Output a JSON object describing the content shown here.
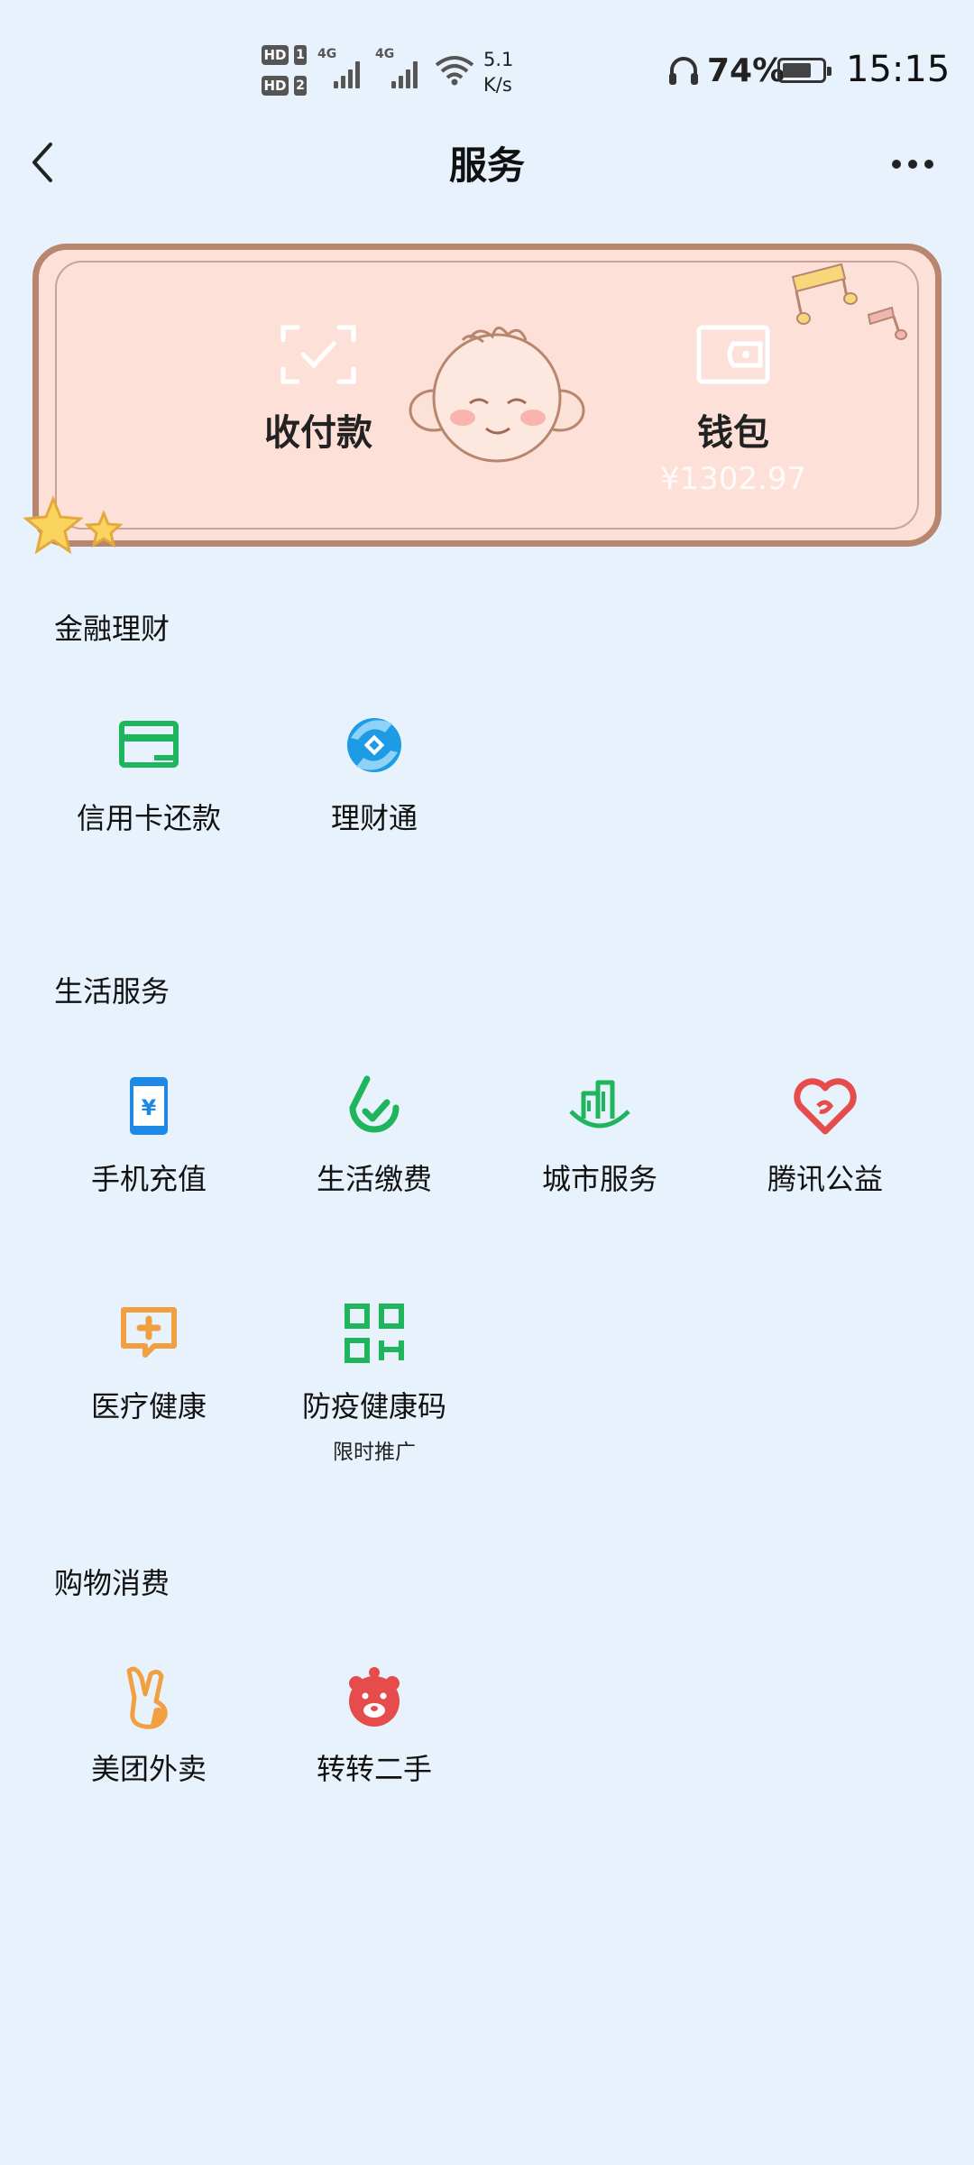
{
  "status_bar": {
    "hd1": "HD",
    "hd1_num": "1",
    "hd2": "HD",
    "hd2_num": "2",
    "net1": "4G",
    "net2": "4G",
    "speed_value": "5.1",
    "speed_unit": "K/s",
    "battery_percent": "74%",
    "battery_level": 0.74,
    "time": "15:15"
  },
  "header": {
    "title": "服务"
  },
  "card": {
    "pay_label": "收付款",
    "wallet_label": "钱包",
    "wallet_balance": "¥1302.97"
  },
  "sections": {
    "finance": {
      "title": "金融理财",
      "items": [
        {
          "label": "信用卡还款",
          "icon": "credit-card-icon"
        },
        {
          "label": "理财通",
          "icon": "licaitong-icon"
        }
      ]
    },
    "life": {
      "title": "生活服务",
      "items": [
        {
          "label": "手机充值",
          "icon": "phone-recharge-icon"
        },
        {
          "label": "生活缴费",
          "icon": "utility-payment-icon"
        },
        {
          "label": "城市服务",
          "icon": "city-service-icon"
        },
        {
          "label": "腾讯公益",
          "icon": "charity-heart-icon"
        },
        {
          "label": "医疗健康",
          "icon": "medical-health-icon"
        },
        {
          "label": "防疫健康码",
          "icon": "health-code-qr-icon",
          "sub": "限时推广"
        }
      ]
    },
    "shopping": {
      "title": "购物消费",
      "items": [
        {
          "label": "美团外卖",
          "icon": "meituan-rabbit-icon"
        },
        {
          "label": "转转二手",
          "icon": "zhuanzhuan-icon"
        }
      ]
    }
  },
  "colors": {
    "background": "#e8f2fd",
    "card_bg": "#fde1d9",
    "card_border": "#b8866f",
    "green": "#1fb55d",
    "blue": "#1e88e5",
    "red": "#e74c4c",
    "orange": "#f0a040"
  }
}
